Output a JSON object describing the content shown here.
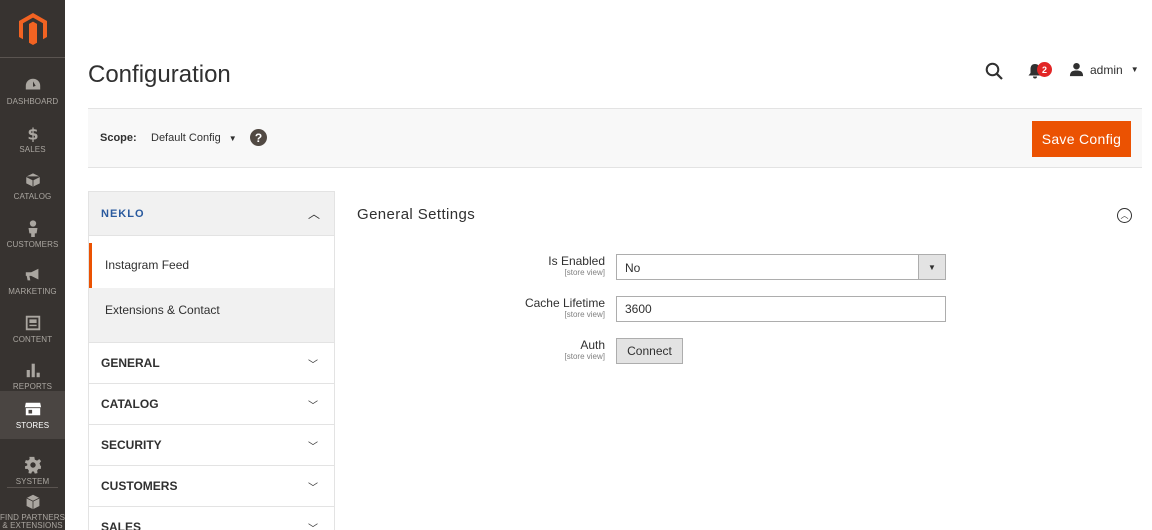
{
  "sidebar": {
    "logo": "magento-logo",
    "items": [
      {
        "label": "DASHBOARD",
        "icon": "dashboard-icon"
      },
      {
        "label": "SALES",
        "icon": "dollar-icon"
      },
      {
        "label": "CATALOG",
        "icon": "box-icon"
      },
      {
        "label": "CUSTOMERS",
        "icon": "person-icon"
      },
      {
        "label": "MARKETING",
        "icon": "megaphone-icon"
      },
      {
        "label": "CONTENT",
        "icon": "content-icon"
      },
      {
        "label": "REPORTS",
        "icon": "bar-chart-icon"
      },
      {
        "label": "STORES",
        "icon": "store-icon",
        "active": true
      },
      {
        "label": "SYSTEM",
        "icon": "gear-icon"
      },
      {
        "label": "FIND PARTNERS & EXTENSIONS",
        "icon": "cube-icon"
      }
    ]
  },
  "header": {
    "title": "Configuration",
    "notifications_count": "2",
    "user": "admin"
  },
  "scope": {
    "label": "Scope:",
    "value": "Default Config",
    "help": "?",
    "save_label": "Save Config"
  },
  "tabs": {
    "brand": "NEKLO",
    "items": [
      "Instagram Feed",
      "Extensions & Contact"
    ],
    "sections": [
      "GENERAL",
      "CATALOG",
      "SECURITY",
      "CUSTOMERS",
      "SALES"
    ]
  },
  "main": {
    "section_title": "General Settings",
    "fields": [
      {
        "label": "Is Enabled",
        "scope": "[store view]",
        "value": "No"
      },
      {
        "label": "Cache Lifetime",
        "scope": "[store view]",
        "value": "3600"
      },
      {
        "label": "Auth",
        "scope": "[store view]",
        "button": "Connect"
      }
    ]
  },
  "colors": {
    "accent": "#eb5202",
    "sidebar": "#373330",
    "badge": "#e22626",
    "brand": "#2a5a9e"
  }
}
